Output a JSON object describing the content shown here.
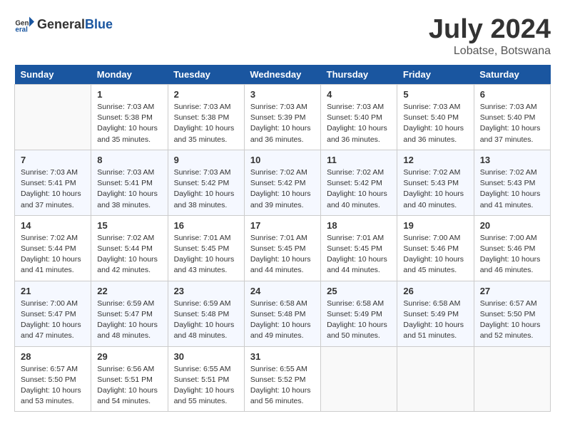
{
  "header": {
    "logo_general": "General",
    "logo_blue": "Blue",
    "month_year": "July 2024",
    "location": "Lobatse, Botswana"
  },
  "days_of_week": [
    "Sunday",
    "Monday",
    "Tuesday",
    "Wednesday",
    "Thursday",
    "Friday",
    "Saturday"
  ],
  "weeks": [
    [
      {
        "day": "",
        "content": ""
      },
      {
        "day": "1",
        "content": "Sunrise: 7:03 AM\nSunset: 5:38 PM\nDaylight: 10 hours\nand 35 minutes."
      },
      {
        "day": "2",
        "content": "Sunrise: 7:03 AM\nSunset: 5:38 PM\nDaylight: 10 hours\nand 35 minutes."
      },
      {
        "day": "3",
        "content": "Sunrise: 7:03 AM\nSunset: 5:39 PM\nDaylight: 10 hours\nand 36 minutes."
      },
      {
        "day": "4",
        "content": "Sunrise: 7:03 AM\nSunset: 5:40 PM\nDaylight: 10 hours\nand 36 minutes."
      },
      {
        "day": "5",
        "content": "Sunrise: 7:03 AM\nSunset: 5:40 PM\nDaylight: 10 hours\nand 36 minutes."
      },
      {
        "day": "6",
        "content": "Sunrise: 7:03 AM\nSunset: 5:40 PM\nDaylight: 10 hours\nand 37 minutes."
      }
    ],
    [
      {
        "day": "7",
        "content": "Sunrise: 7:03 AM\nSunset: 5:41 PM\nDaylight: 10 hours\nand 37 minutes."
      },
      {
        "day": "8",
        "content": "Sunrise: 7:03 AM\nSunset: 5:41 PM\nDaylight: 10 hours\nand 38 minutes."
      },
      {
        "day": "9",
        "content": "Sunrise: 7:03 AM\nSunset: 5:42 PM\nDaylight: 10 hours\nand 38 minutes."
      },
      {
        "day": "10",
        "content": "Sunrise: 7:02 AM\nSunset: 5:42 PM\nDaylight: 10 hours\nand 39 minutes."
      },
      {
        "day": "11",
        "content": "Sunrise: 7:02 AM\nSunset: 5:42 PM\nDaylight: 10 hours\nand 40 minutes."
      },
      {
        "day": "12",
        "content": "Sunrise: 7:02 AM\nSunset: 5:43 PM\nDaylight: 10 hours\nand 40 minutes."
      },
      {
        "day": "13",
        "content": "Sunrise: 7:02 AM\nSunset: 5:43 PM\nDaylight: 10 hours\nand 41 minutes."
      }
    ],
    [
      {
        "day": "14",
        "content": "Sunrise: 7:02 AM\nSunset: 5:44 PM\nDaylight: 10 hours\nand 41 minutes."
      },
      {
        "day": "15",
        "content": "Sunrise: 7:02 AM\nSunset: 5:44 PM\nDaylight: 10 hours\nand 42 minutes."
      },
      {
        "day": "16",
        "content": "Sunrise: 7:01 AM\nSunset: 5:45 PM\nDaylight: 10 hours\nand 43 minutes."
      },
      {
        "day": "17",
        "content": "Sunrise: 7:01 AM\nSunset: 5:45 PM\nDaylight: 10 hours\nand 44 minutes."
      },
      {
        "day": "18",
        "content": "Sunrise: 7:01 AM\nSunset: 5:45 PM\nDaylight: 10 hours\nand 44 minutes."
      },
      {
        "day": "19",
        "content": "Sunrise: 7:00 AM\nSunset: 5:46 PM\nDaylight: 10 hours\nand 45 minutes."
      },
      {
        "day": "20",
        "content": "Sunrise: 7:00 AM\nSunset: 5:46 PM\nDaylight: 10 hours\nand 46 minutes."
      }
    ],
    [
      {
        "day": "21",
        "content": "Sunrise: 7:00 AM\nSunset: 5:47 PM\nDaylight: 10 hours\nand 47 minutes."
      },
      {
        "day": "22",
        "content": "Sunrise: 6:59 AM\nSunset: 5:47 PM\nDaylight: 10 hours\nand 48 minutes."
      },
      {
        "day": "23",
        "content": "Sunrise: 6:59 AM\nSunset: 5:48 PM\nDaylight: 10 hours\nand 48 minutes."
      },
      {
        "day": "24",
        "content": "Sunrise: 6:58 AM\nSunset: 5:48 PM\nDaylight: 10 hours\nand 49 minutes."
      },
      {
        "day": "25",
        "content": "Sunrise: 6:58 AM\nSunset: 5:49 PM\nDaylight: 10 hours\nand 50 minutes."
      },
      {
        "day": "26",
        "content": "Sunrise: 6:58 AM\nSunset: 5:49 PM\nDaylight: 10 hours\nand 51 minutes."
      },
      {
        "day": "27",
        "content": "Sunrise: 6:57 AM\nSunset: 5:50 PM\nDaylight: 10 hours\nand 52 minutes."
      }
    ],
    [
      {
        "day": "28",
        "content": "Sunrise: 6:57 AM\nSunset: 5:50 PM\nDaylight: 10 hours\nand 53 minutes."
      },
      {
        "day": "29",
        "content": "Sunrise: 6:56 AM\nSunset: 5:51 PM\nDaylight: 10 hours\nand 54 minutes."
      },
      {
        "day": "30",
        "content": "Sunrise: 6:55 AM\nSunset: 5:51 PM\nDaylight: 10 hours\nand 55 minutes."
      },
      {
        "day": "31",
        "content": "Sunrise: 6:55 AM\nSunset: 5:52 PM\nDaylight: 10 hours\nand 56 minutes."
      },
      {
        "day": "",
        "content": ""
      },
      {
        "day": "",
        "content": ""
      },
      {
        "day": "",
        "content": ""
      }
    ]
  ]
}
